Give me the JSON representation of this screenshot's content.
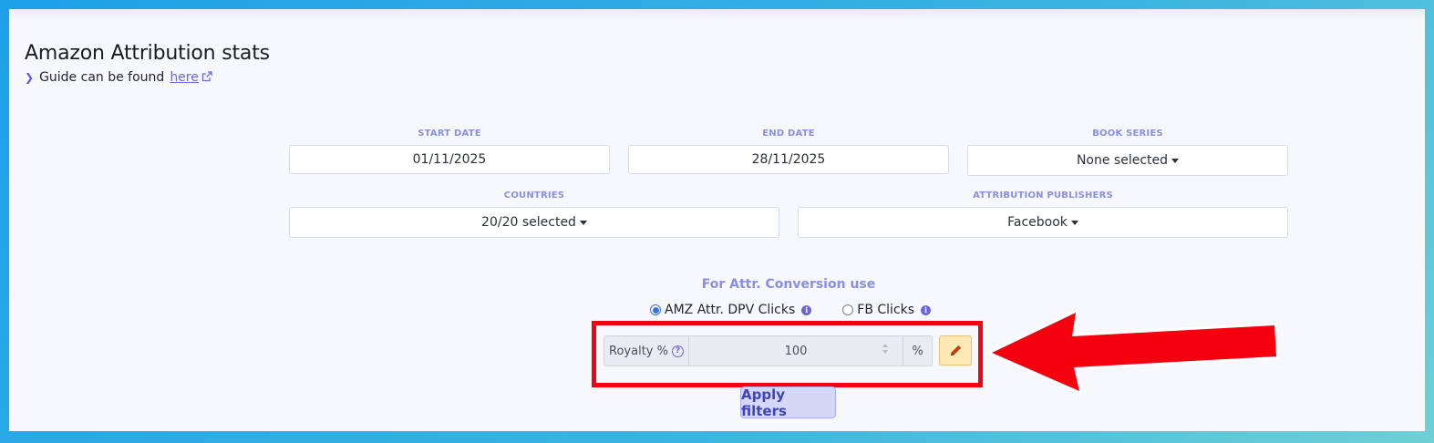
{
  "page": {
    "title": "Amazon Attribution stats",
    "guide_text": "Guide can be found",
    "guide_link": "here"
  },
  "filters": {
    "start_date": {
      "label": "START DATE",
      "value": "01/11/2025"
    },
    "end_date": {
      "label": "END DATE",
      "value": "28/11/2025"
    },
    "book_series": {
      "label": "BOOK SERIES",
      "value": "None selected"
    },
    "countries": {
      "label": "COUNTRIES",
      "value": "20/20 selected"
    },
    "publishers": {
      "label": "ATTRIBUTION PUBLISHERS",
      "value": "Facebook"
    }
  },
  "conversion": {
    "title": "For Attr. Conversion use",
    "options": [
      {
        "label": "AMZ Attr. DPV Clicks",
        "selected": true
      },
      {
        "label": "FB Clicks",
        "selected": false
      }
    ]
  },
  "royalty": {
    "label": "Royalty %",
    "value": "100",
    "unit": "%"
  },
  "apply_label": "Apply filters",
  "colors": {
    "accent": "#6a66d8",
    "highlight": "#f5000e",
    "edit_button": "#fde9b6"
  },
  "icons": [
    "external-link-icon",
    "info-icon",
    "help-icon",
    "pencil-icon",
    "red-arrow-annotation"
  ]
}
